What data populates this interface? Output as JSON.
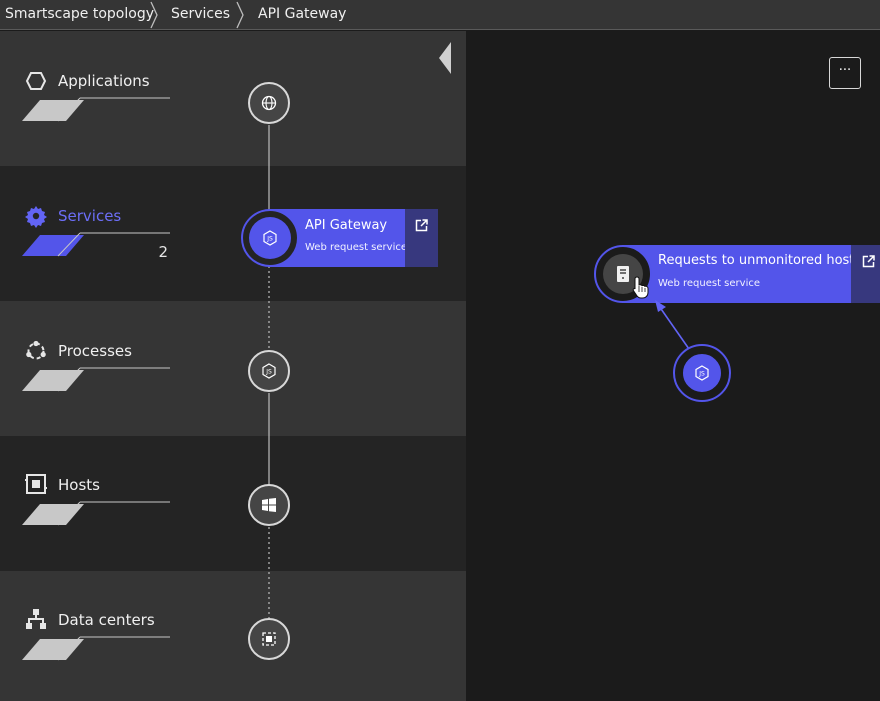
{
  "breadcrumb": [
    {
      "label": "Smartscape topology"
    },
    {
      "label": "Services"
    },
    {
      "label": "API Gateway"
    }
  ],
  "layers": [
    {
      "label": "Applications",
      "icon": "hexagon-icon",
      "count": ""
    },
    {
      "label": "Services",
      "icon": "gear-icon",
      "count": "2",
      "active": true
    },
    {
      "label": "Processes",
      "icon": "processes-icon",
      "count": ""
    },
    {
      "label": "Hosts",
      "icon": "host-icon",
      "count": ""
    },
    {
      "label": "Data centers",
      "icon": "datacenter-icon",
      "count": ""
    }
  ],
  "selected_service": {
    "name": "API Gateway",
    "type": "Web request service",
    "icon": "nodejs-icon"
  },
  "canvas": {
    "menu_label": "···",
    "service": {
      "name": "Requests to unmonitored hosts",
      "type": "Web request service",
      "icon": "server-icon"
    },
    "caller_icon": "nodejs-icon"
  },
  "colors": {
    "accent": "#5355ea",
    "accent_dark": "#37387e",
    "row_dark": "#242424",
    "row_light": "#353535",
    "canvas": "#1b1b1b"
  }
}
